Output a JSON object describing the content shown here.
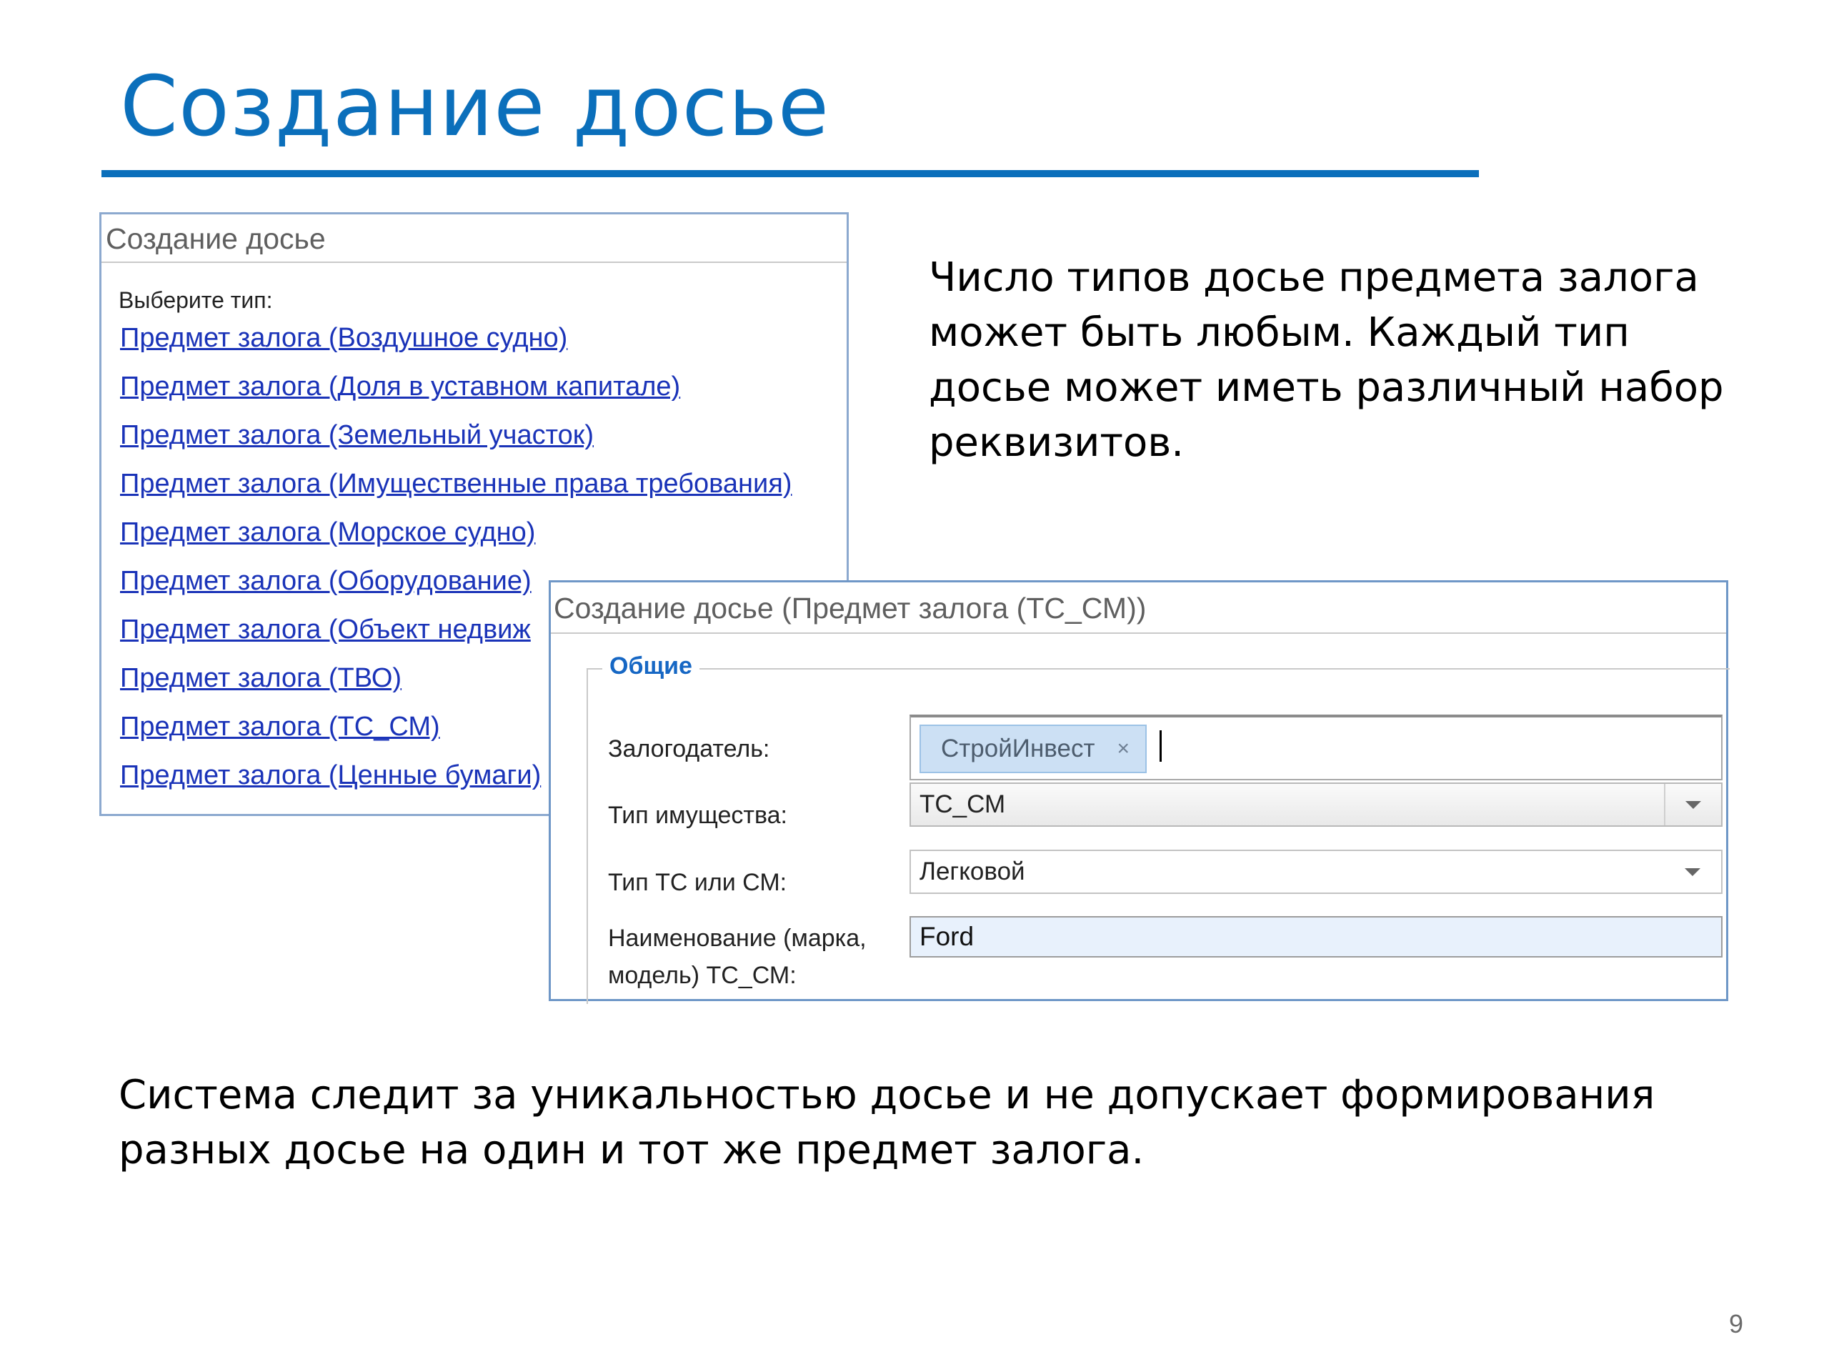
{
  "slide": {
    "title": "Создание досье",
    "side_text": "Число типов досье предмета залога может быть любым. Каждый тип досье может иметь различный набор реквизитов.",
    "bottom_text": "Система следит за уникальностью досье и не допускает формирования разных досье на один и тот же предмет залога.",
    "page_number": "9"
  },
  "type_panel": {
    "header": "Создание досье",
    "select_label": "Выберите тип:",
    "items": [
      {
        "label": "Предмет залога (Воздушное судно)"
      },
      {
        "label": "Предмет залога (Доля в уставном капитале)"
      },
      {
        "label": "Предмет залога (Земельный участок)"
      },
      {
        "label": "Предмет залога (Имущественные права требования)"
      },
      {
        "label": "Предмет залога (Морское судно)"
      },
      {
        "label": "Предмет залога (Оборудование)"
      },
      {
        "label": "Предмет залога (Объект недвиж"
      },
      {
        "label": "Предмет залога (ТВО)"
      },
      {
        "label": "Предмет залога (ТС_СМ)"
      },
      {
        "label": "Предмет залога (Ценные бумаги)"
      }
    ]
  },
  "form_panel": {
    "header": "Создание досье (Предмет залога (ТС_СМ))",
    "section_legend": "Общие",
    "fields": {
      "pledger": {
        "label": "Залогодатель:",
        "tag": "СтройИнвест",
        "tag_remove": "×"
      },
      "property_type": {
        "label": "Тип имущества:",
        "value": "ТС_СМ"
      },
      "vehicle_type": {
        "label": "Тип ТС или СМ:",
        "value": "Легковой"
      },
      "name": {
        "label_line1": "Наименование (марка,",
        "label_line2": "модель) ТС_СМ:",
        "value": "Ford"
      }
    }
  },
  "colors": {
    "title_blue": "#0B6FBB",
    "link_blue": "#1a33b8",
    "legend_blue": "#1667c4",
    "panel_border": "#6f97c7"
  }
}
